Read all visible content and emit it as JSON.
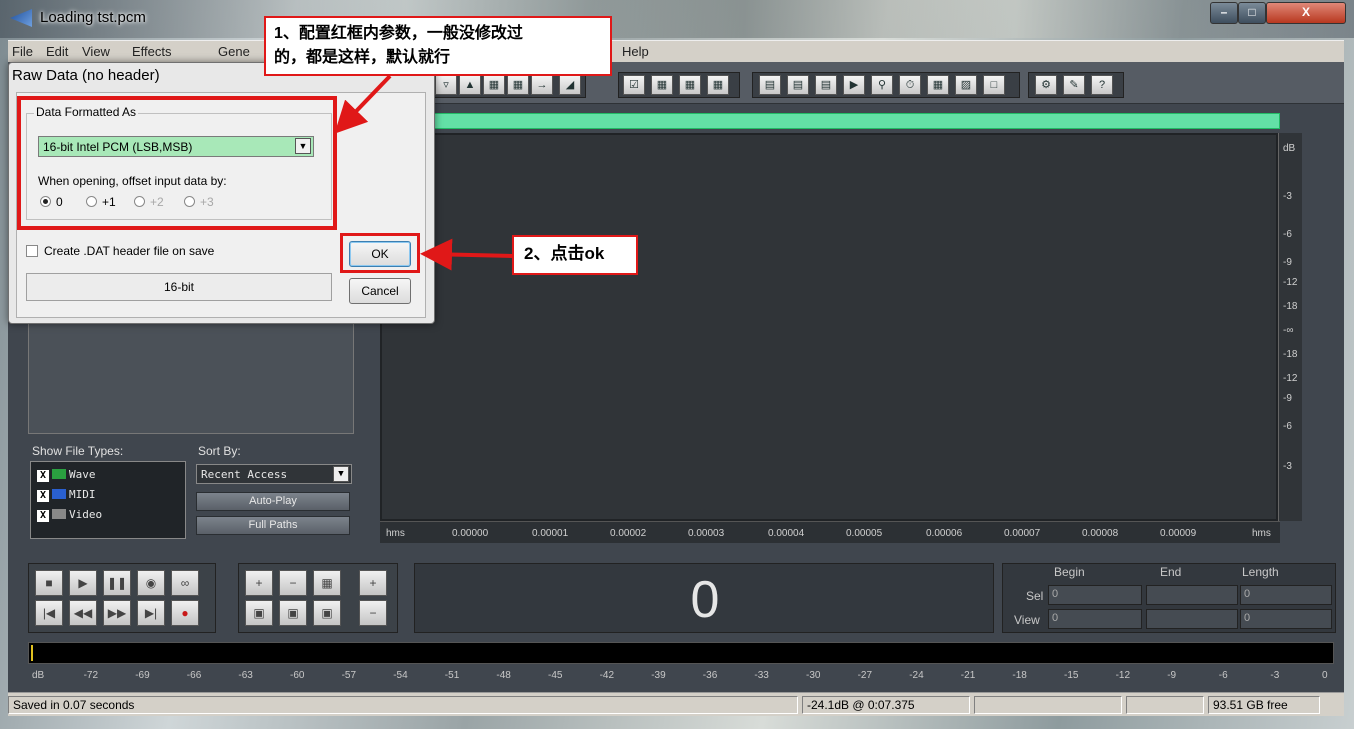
{
  "window": {
    "title": "Loading tst.pcm"
  },
  "menu": [
    "File",
    "Edit",
    "View",
    "Effects",
    "Gene",
    "Help"
  ],
  "dialog": {
    "title": "Raw Data (no header)",
    "group_label": "Data Formatted As",
    "format_value": "16-bit Intel PCM (LSB,MSB)",
    "offset_label": "When opening, offset input data by:",
    "offset_options": [
      "0",
      "+1",
      "+2",
      "+3"
    ],
    "offset_selected": "0",
    "dat_checkbox_label": "Create .DAT header file on save",
    "bit_depth": "16-bit",
    "ok_label": "OK",
    "cancel_label": "Cancel"
  },
  "annotations": {
    "callout_1_line1": "1、配置红框内参数，一般没修改过",
    "callout_1_line2": "的，都是这样，默认就行",
    "callout_2": "2、点击ok",
    "accent_color": "#e01818"
  },
  "file_panel": {
    "show_types_label": "Show File Types:",
    "sort_by_label": "Sort By:",
    "types": [
      "Wave",
      "MIDI",
      "Video"
    ],
    "sort_value": "Recent Access",
    "auto_play_label": "Auto-Play",
    "full_paths_label": "Full Paths"
  },
  "waveform": {
    "db_labels": [
      "dB",
      "-3",
      "-6",
      "-9",
      "-12",
      "-18",
      "-∞",
      "-18",
      "-12",
      "-9",
      "-6",
      "-3"
    ],
    "time_unit": "hms",
    "time_ticks": [
      "0.00000",
      "0.00001",
      "0.00002",
      "0.00003",
      "0.00004",
      "0.00005",
      "0.00006",
      "0.00007",
      "0.00008",
      "0.00009"
    ]
  },
  "display": {
    "time_value": "0",
    "col_begin": "Begin",
    "col_end": "End",
    "col_length": "Length",
    "row_sel": "Sel",
    "row_view": "View",
    "sel_begin": "0",
    "sel_length": "0",
    "view_begin": "0",
    "view_length": "0"
  },
  "meter": {
    "labels": [
      "dB",
      "-72",
      "-69",
      "-66",
      "-63",
      "-60",
      "-57",
      "-54",
      "-51",
      "-48",
      "-45",
      "-42",
      "-39",
      "-36",
      "-33",
      "-30",
      "-27",
      "-24",
      "-21",
      "-18",
      "-15",
      "-12",
      "-9",
      "-6",
      "-3",
      "0"
    ]
  },
  "status": {
    "message": "Saved in 0.07 seconds",
    "level_time": "-24.1dB @  0:07.375",
    "free_space": "93.51 GB free"
  }
}
